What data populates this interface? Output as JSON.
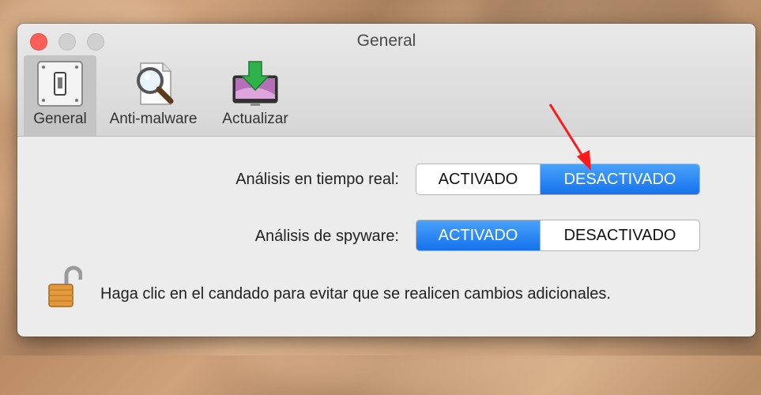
{
  "window": {
    "title": "General"
  },
  "toolbar": {
    "tabs": [
      {
        "label": "General",
        "icon": "light-switch-icon",
        "selected": true
      },
      {
        "label": "Anti-malware",
        "icon": "magnifier-document-icon",
        "selected": false
      },
      {
        "label": "Actualizar",
        "icon": "download-monitor-icon",
        "selected": false
      }
    ]
  },
  "settings": {
    "realtime": {
      "label": "Análisis en tiempo real:",
      "on_label": "ACTIVADO",
      "off_label": "DESACTIVADO",
      "selected": "DESACTIVADO"
    },
    "spyware": {
      "label": "Análisis de spyware:",
      "on_label": "ACTIVADO",
      "off_label": "DESACTIVADO",
      "selected": "ACTIVADO"
    }
  },
  "lock": {
    "icon": "open-padlock-icon",
    "text": "Haga clic en el candado para evitar que se realicen cambios adicionales."
  },
  "annotation": {
    "icon": "red-arrow-icon",
    "color": "#ff1a1a"
  },
  "colors": {
    "accent": "#1b78ee",
    "close": "#fc5f57"
  }
}
